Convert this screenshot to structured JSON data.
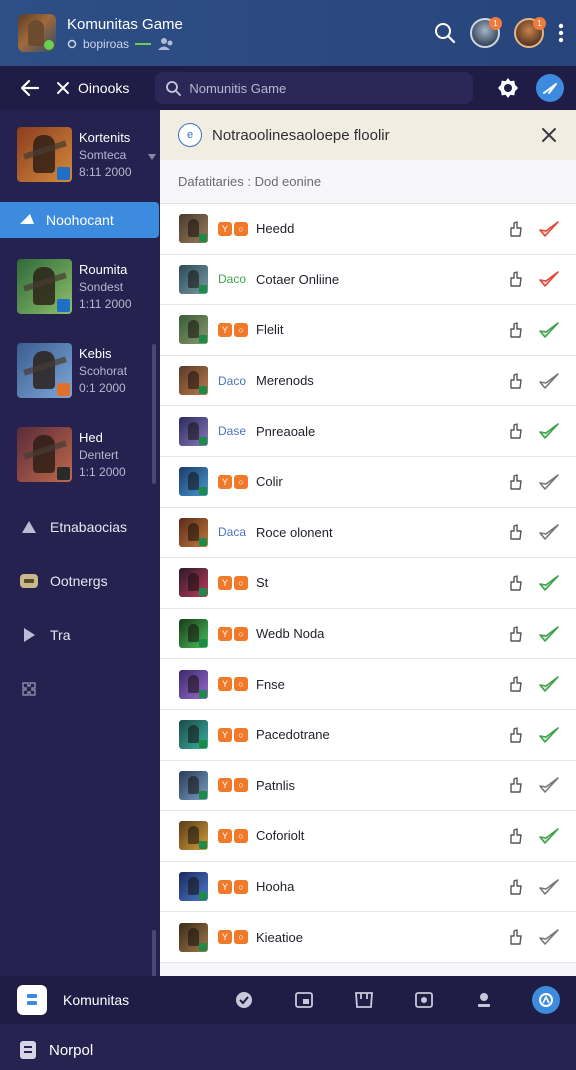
{
  "header": {
    "title": "Komunitas Game",
    "subtitle": "bopiroas",
    "avatar1_badge": "1",
    "avatar2_badge": "1"
  },
  "toolbar": {
    "close_label": "Oinooks",
    "search_placeholder": "Nomunitis Game"
  },
  "sidebar": {
    "games": [
      {
        "name": "Kortenits",
        "sub": "Somteca",
        "date": "8:11 2000",
        "colors": [
          "#8b3d1f",
          "#d58a3a"
        ]
      },
      {
        "name": "Roumita",
        "sub": "Sondest",
        "date": "1:11 2000",
        "colors": [
          "#2e6a3a",
          "#8fbf6a"
        ]
      },
      {
        "name": "Kebis",
        "sub": "Scohorat",
        "date": "0:1 2000",
        "colors": [
          "#3b5c8f",
          "#7ea8d8"
        ]
      },
      {
        "name": "Hed",
        "sub": "Dentert",
        "date": "1:1 2000",
        "colors": [
          "#5a2a3a",
          "#c06a4a"
        ]
      }
    ],
    "active_label": "Noohocant",
    "items": [
      {
        "label": "Etnabaocias",
        "icon": "triangle-icon"
      },
      {
        "label": "Ootnergs",
        "icon": "badge-icon"
      },
      {
        "label": "Tra",
        "icon": "play-icon"
      },
      {
        "label": "",
        "icon": "puzzle-icon"
      }
    ],
    "bottom_label": "Norpol"
  },
  "main": {
    "banner_text": "Notraoolinesaoloepe floolir",
    "banner_icon_text": "e",
    "subhead": "Dafatitaries : Dod eonine",
    "rows": [
      {
        "name": "Heedd",
        "tag": "icons",
        "tag_text": "",
        "check": "red",
        "colors": [
          "#4a3a30",
          "#9a7a5a"
        ]
      },
      {
        "name": "Cotaer Onliine",
        "tag": "green",
        "tag_text": "Daco",
        "check": "red",
        "colors": [
          "#2a4a5a",
          "#7a9aa0"
        ]
      },
      {
        "name": "Flelit",
        "tag": "icons",
        "tag_text": "",
        "check": "green",
        "colors": [
          "#3a5a3a",
          "#8a9a6a"
        ]
      },
      {
        "name": "Merenods",
        "tag": "blue",
        "tag_text": "Daco",
        "check": "outline",
        "colors": [
          "#5a3a2a",
          "#b87a4a"
        ]
      },
      {
        "name": "Pnreaoale",
        "tag": "blue",
        "tag_text": "Dase",
        "check": "green",
        "colors": [
          "#2a2a5a",
          "#8a7ac0"
        ]
      },
      {
        "name": "Colir",
        "tag": "icons",
        "tag_text": "",
        "check": "outline",
        "colors": [
          "#1a3a6a",
          "#4a9ad0"
        ]
      },
      {
        "name": "Roce olonent",
        "tag": "blue",
        "tag_text": "Daca",
        "check": "outline",
        "colors": [
          "#5a2a1a",
          "#c07a3a"
        ]
      },
      {
        "name": "St",
        "tag": "icons",
        "tag_text": "",
        "check": "green",
        "colors": [
          "#2a1a2a",
          "#c03a5a"
        ]
      },
      {
        "name": "Wedb Noda",
        "tag": "icons",
        "tag_text": "",
        "check": "green",
        "colors": [
          "#1a3a1a",
          "#4ac05a"
        ]
      },
      {
        "name": "Fnse",
        "tag": "icons",
        "tag_text": "",
        "check": "green",
        "colors": [
          "#3a2a6a",
          "#9a6ad0"
        ]
      },
      {
        "name": "Pacedotrane",
        "tag": "icons",
        "tag_text": "",
        "check": "green",
        "colors": [
          "#1a4a4a",
          "#3ab0a0"
        ]
      },
      {
        "name": "Patnlis",
        "tag": "icons",
        "tag_text": "",
        "check": "outline",
        "colors": [
          "#2a3a5a",
          "#7aa0c0"
        ]
      },
      {
        "name": "Coforiolt",
        "tag": "icons",
        "tag_text": "",
        "check": "green",
        "colors": [
          "#5a3a1a",
          "#d0a03a"
        ]
      },
      {
        "name": "Hooha",
        "tag": "icons",
        "tag_text": "",
        "check": "outline",
        "colors": [
          "#1a2a5a",
          "#4a7ad0"
        ]
      },
      {
        "name": "Kieatioe",
        "tag": "icons",
        "tag_text": "",
        "check": "outline",
        "colors": [
          "#3a2a1a",
          "#a07a4a"
        ]
      }
    ]
  },
  "bottom_bar": {
    "label": "Komunitas"
  },
  "colors": {
    "accent": "#3c8bdf",
    "check_red": "#e0483a",
    "check_green": "#3ea34c"
  }
}
